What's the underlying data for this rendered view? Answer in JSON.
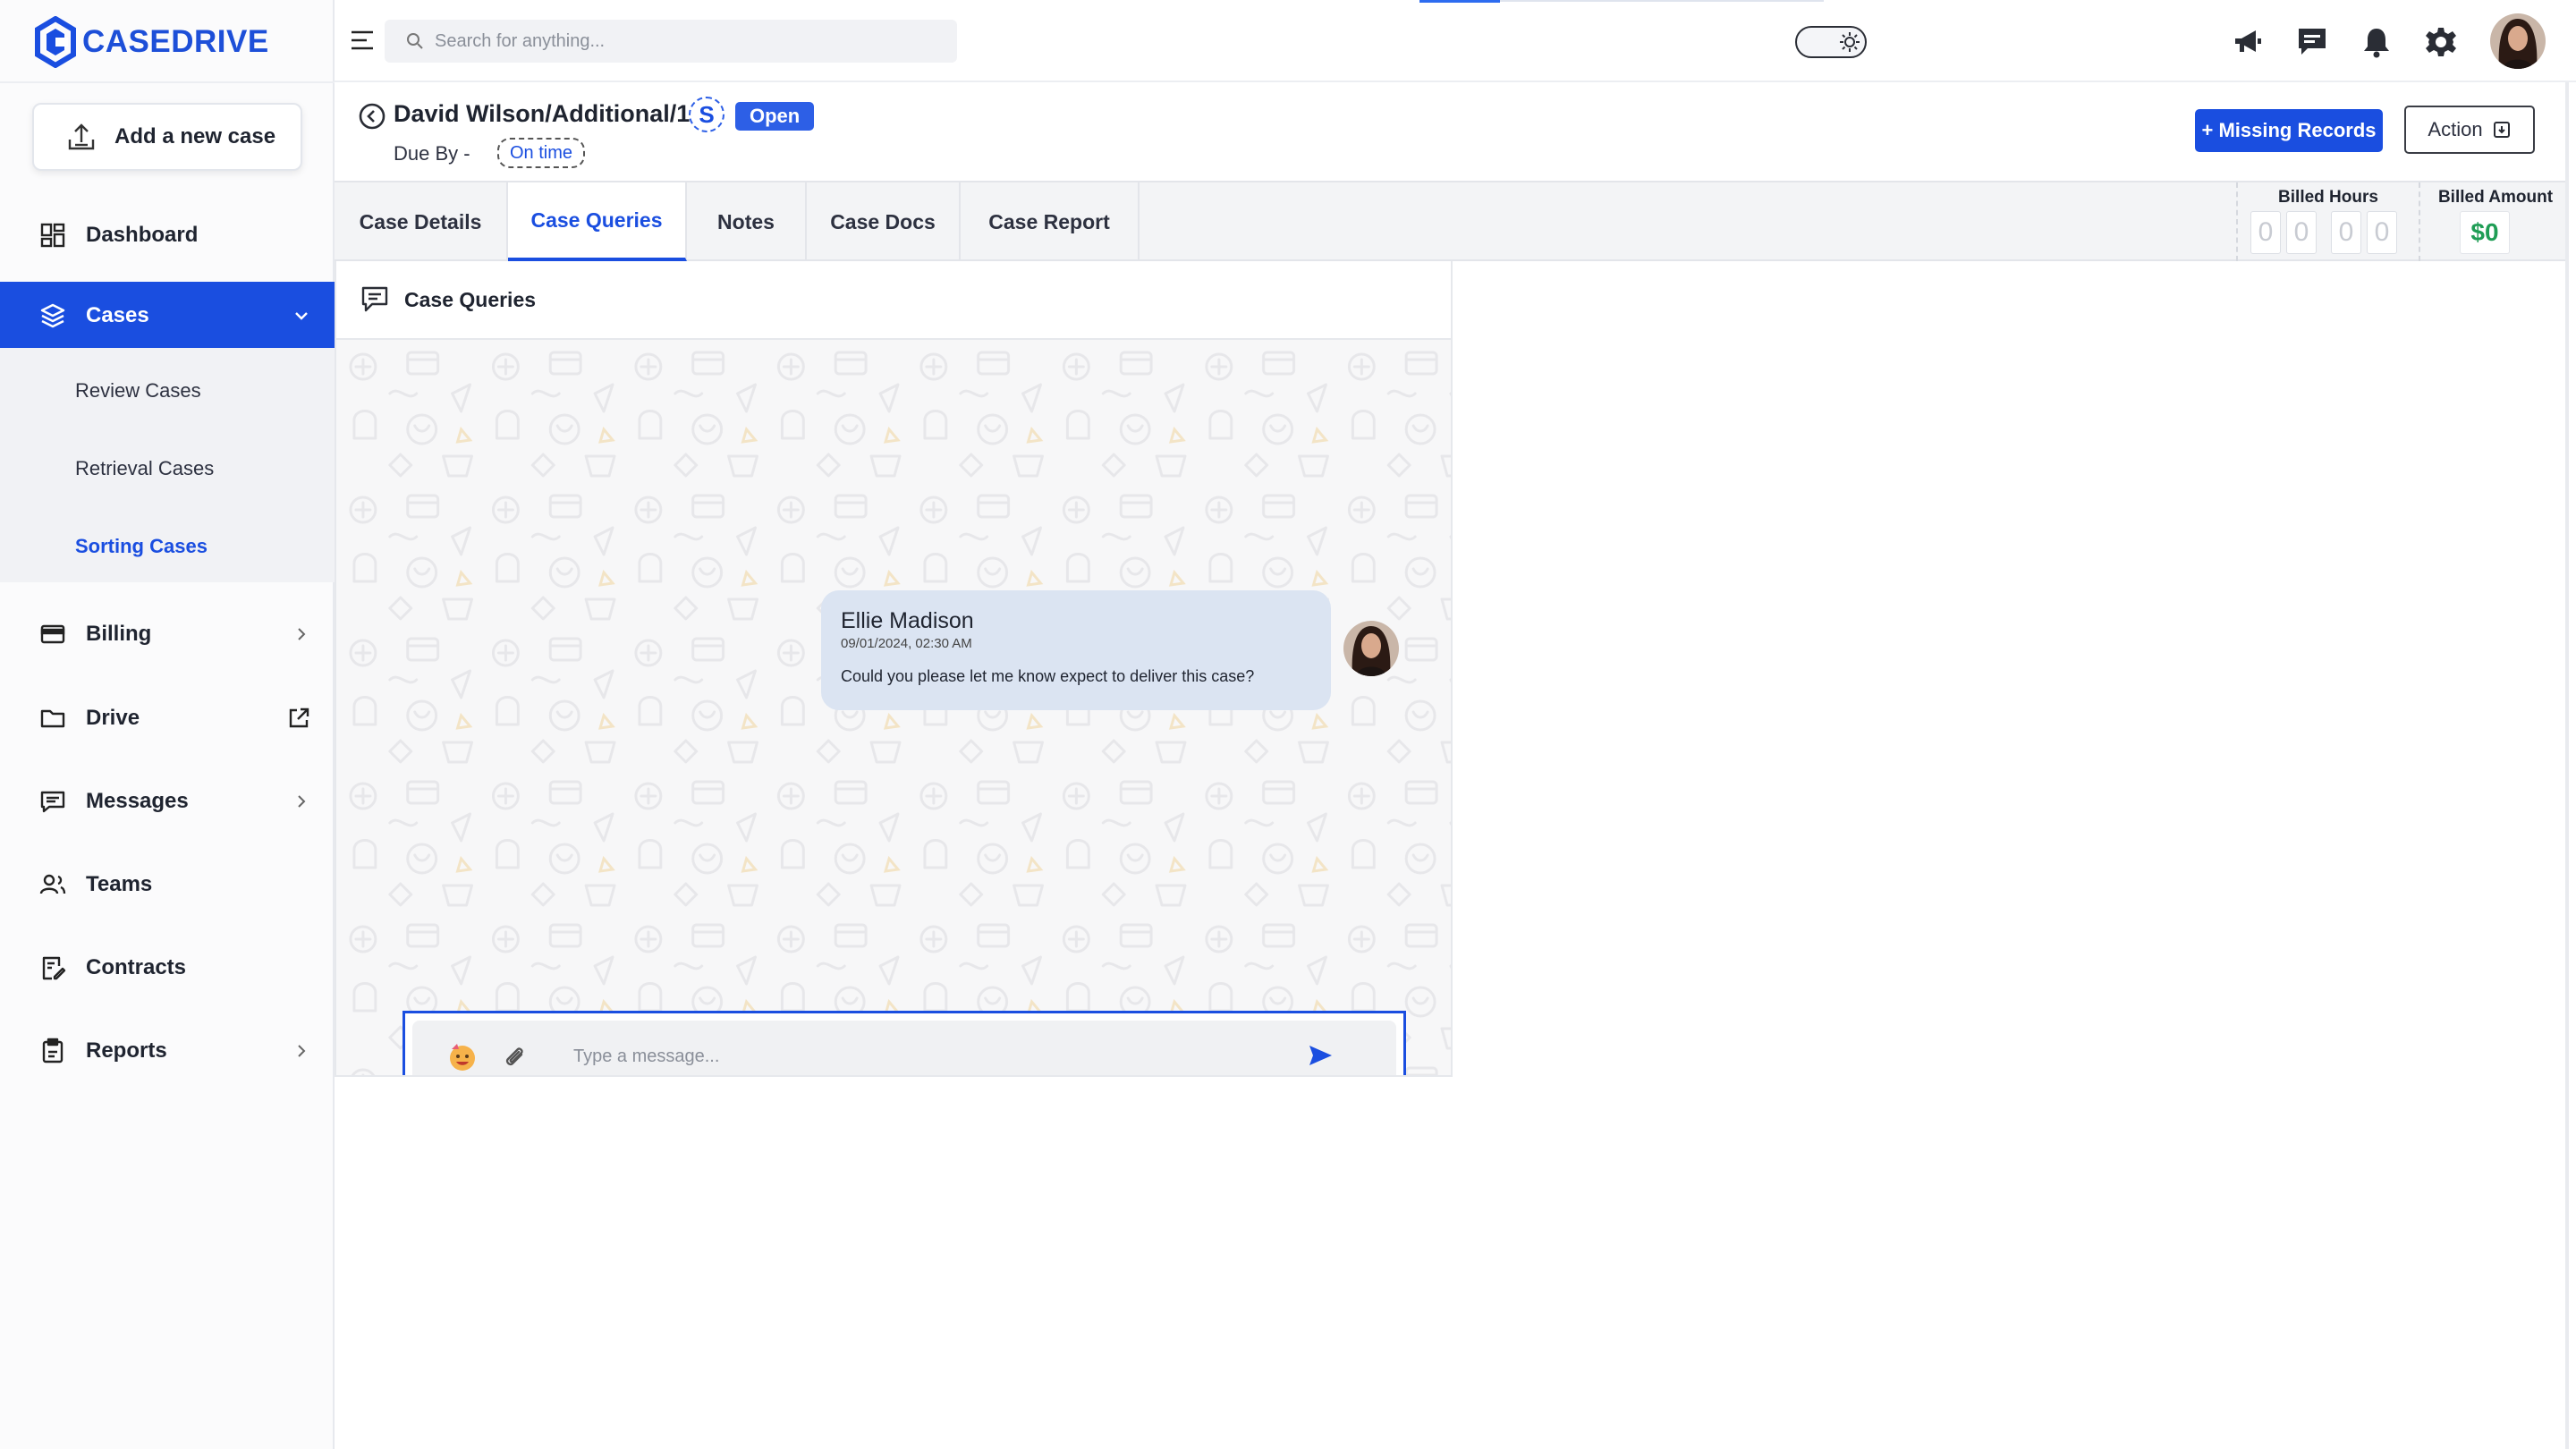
{
  "brand": {
    "name": "CASEDRIVE",
    "color": "#1a4ee0"
  },
  "search": {
    "placeholder": "Search for anything..."
  },
  "sidebar": {
    "add_case_label": "Add a new case",
    "items": [
      {
        "label": "Dashboard",
        "icon": "dashboard-icon"
      },
      {
        "label": "Cases",
        "icon": "layers-icon",
        "active": true
      },
      {
        "label": "Billing",
        "icon": "credit-card-icon"
      },
      {
        "label": "Drive",
        "icon": "folder-icon"
      },
      {
        "label": "Messages",
        "icon": "message-icon"
      },
      {
        "label": "Teams",
        "icon": "users-icon"
      },
      {
        "label": "Contracts",
        "icon": "contract-icon"
      },
      {
        "label": "Reports",
        "icon": "clipboard-icon"
      }
    ],
    "sub_items": [
      {
        "label": "Review Cases"
      },
      {
        "label": "Retrieval Cases"
      },
      {
        "label": "Sorting Cases",
        "active": true
      }
    ]
  },
  "case": {
    "title": "David Wilson/Additional/1",
    "s_badge": "S",
    "status": "Open",
    "due_label": "Due By -",
    "due_status": "On time",
    "missing_records_label": "+ Missing Records",
    "action_label": "Action"
  },
  "tabs": [
    {
      "label": "Case Details"
    },
    {
      "label": "Case Queries",
      "active": true
    },
    {
      "label": "Notes"
    },
    {
      "label": "Case Docs"
    },
    {
      "label": "Case Report"
    }
  ],
  "billing": {
    "hours_label": "Billed Hours",
    "hours_digits": [
      "0",
      "0",
      "0",
      "0"
    ],
    "amount_label": "Billed Amount",
    "amount_value": "$0"
  },
  "chat": {
    "title": "Case Queries",
    "messages": [
      {
        "sender": "Ellie Madison",
        "timestamp": "09/01/2024, 02:30 AM",
        "text": "Could you please let me know expect to deliver this case?"
      }
    ],
    "input_placeholder": "Type a message..."
  },
  "colors": {
    "accent": "#1a4ee0",
    "success": "#1f9d55",
    "sidebar_bg": "#fbfbfc",
    "bubble": "#dbe4f2"
  }
}
